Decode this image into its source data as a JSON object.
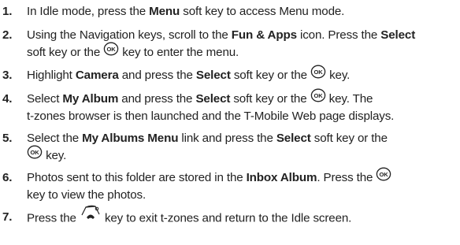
{
  "steps": [
    {
      "num": "1.",
      "lines": [
        [
          {
            "t": "In Idle mode, press the "
          },
          {
            "t": "Menu",
            "b": true
          },
          {
            "t": " soft key to access Menu mode."
          }
        ]
      ]
    },
    {
      "num": "2.",
      "lines": [
        [
          {
            "t": "Using the Navigation keys, scroll to the "
          },
          {
            "t": "Fun & Apps",
            "b": true
          },
          {
            "t": " icon. Press the "
          },
          {
            "t": "Select",
            "b": true
          }
        ],
        [
          {
            "t": "soft key or the "
          },
          {
            "icon": "ok-key-icon"
          },
          {
            "t": " key to enter the menu."
          }
        ]
      ]
    },
    {
      "num": "3.",
      "lines": [
        [
          {
            "t": "Highlight "
          },
          {
            "t": "Camera",
            "b": true
          },
          {
            "t": " and press the "
          },
          {
            "t": "Select",
            "b": true
          },
          {
            "t": " soft key or the "
          },
          {
            "icon": "ok-key-icon"
          },
          {
            "t": " key."
          }
        ]
      ]
    },
    {
      "num": "4.",
      "lines": [
        [
          {
            "t": "Select "
          },
          {
            "t": "My Album",
            "b": true
          },
          {
            "t": " and press the "
          },
          {
            "t": "Select",
            "b": true
          },
          {
            "t": " soft key or the "
          },
          {
            "icon": "ok-key-icon"
          },
          {
            "t": " key. The"
          }
        ],
        [
          {
            "t": "t-zones browser is then launched and the T-Mobile Web page displays."
          }
        ]
      ]
    },
    {
      "num": "5.",
      "lines": [
        [
          {
            "t": "Select the "
          },
          {
            "t": "My Albums Menu",
            "b": true
          },
          {
            "t": " link and press the "
          },
          {
            "t": "Select",
            "b": true
          },
          {
            "t": " soft key or the"
          }
        ],
        [
          {
            "icon": "ok-key-icon"
          },
          {
            "t": " key."
          }
        ]
      ]
    },
    {
      "num": "6.",
      "lines": [
        [
          {
            "t": "Photos sent to this folder are stored in the "
          },
          {
            "t": "Inbox Album",
            "b": true
          },
          {
            "t": ". Press the "
          },
          {
            "icon": "ok-key-icon"
          }
        ],
        [
          {
            "t": "key to view the photos."
          }
        ]
      ]
    },
    {
      "num": "7.",
      "lines": [
        [
          {
            "t": "Press the "
          },
          {
            "icon": "end-key-icon"
          },
          {
            "t": " key to exit t-zones and return to the Idle screen."
          }
        ]
      ]
    }
  ]
}
